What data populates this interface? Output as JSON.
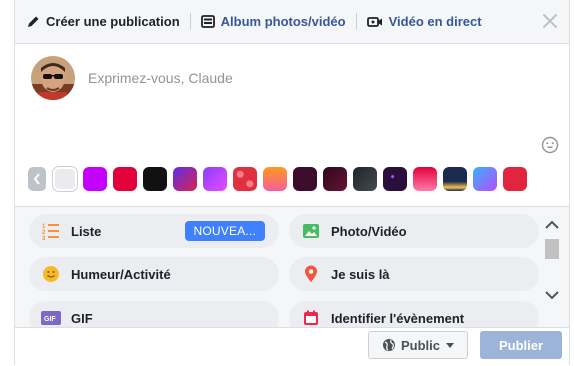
{
  "tabs": {
    "create_post": "Créer une publication",
    "album": "Album photos/vidéo",
    "live": "Vidéo en direct"
  },
  "composer": {
    "placeholder": "Exprimez-vous, Claude"
  },
  "colors": {
    "swatches": [
      "#e9ebee",
      "#c600ff",
      "#e2013b",
      "#111111",
      "gradient-blue-purple-red",
      "gradient-purple-pink",
      "pattern-red-circles",
      "gradient-orange-yellow",
      "#3b0d2a",
      "gradient-dark-maroon",
      "#2d3439",
      "pattern-dark-stars",
      "gradient-red-pink",
      "gradient-navy-cityscape",
      "gradient-blue-purple",
      "#e2253e"
    ]
  },
  "actions": {
    "list": {
      "label": "Liste",
      "badge": "NOUVEA..."
    },
    "photo": {
      "label": "Photo/Vidéo"
    },
    "mood": {
      "label": "Humeur/Activité"
    },
    "checkin": {
      "label": "Je suis là"
    },
    "gif": {
      "label": "GIF"
    },
    "event": {
      "label": "Identifier l'évènement"
    }
  },
  "footer": {
    "privacy": "Public",
    "publish": "Publier"
  }
}
